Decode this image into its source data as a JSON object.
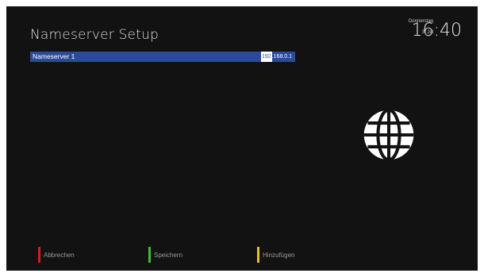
{
  "header": {
    "title": "Nameserver Setup",
    "weekday": "Donnerstag",
    "date": "3. Jul",
    "time": "16:40"
  },
  "config_list": {
    "items": [
      {
        "label": "Nameserver 1",
        "value_selected": "192",
        "value_rest": ".168.0.1"
      }
    ]
  },
  "icons": {
    "main": "globe-icon"
  },
  "footer": {
    "buttons": [
      {
        "label": "Abbrechen",
        "color": "#d01f1f"
      },
      {
        "label": "Speichern",
        "color": "#3cbf2f"
      },
      {
        "label": "Hinzufügen",
        "color": "#e0c422"
      }
    ]
  },
  "colors": {
    "background": "#121212",
    "selection": "#2c4a9a"
  }
}
